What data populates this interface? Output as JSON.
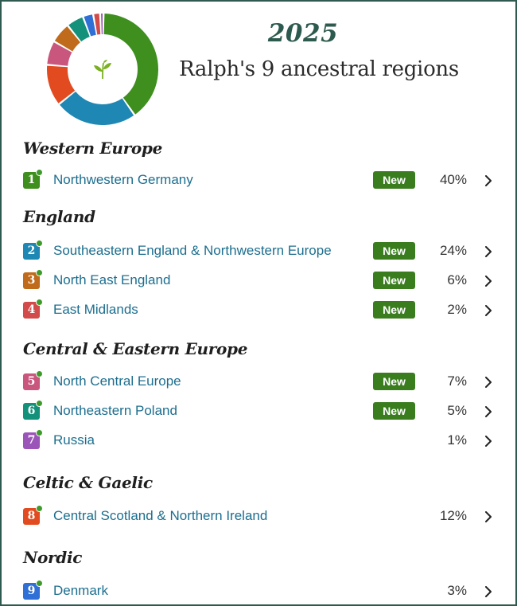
{
  "header": {
    "year": "2025",
    "headline": "Ralph's 9 ancestral regions"
  },
  "chart_data": {
    "type": "pie",
    "style": "donut",
    "categories": [
      "Northwestern Germany",
      "Southeastern England & Northwestern Europe",
      "Central Scotland & Northern Ireland",
      "North Central Europe",
      "North East England",
      "Northeastern Poland",
      "Denmark",
      "East Midlands",
      "Russia"
    ],
    "values": [
      40,
      24,
      12,
      7,
      6,
      5,
      3,
      2,
      1
    ],
    "colors": [
      "#3f8f1f",
      "#1e87b3",
      "#e24b1f",
      "#c9567d",
      "#c06a1b",
      "#14917a",
      "#2f6fd6",
      "#d24a4a",
      "#9b55b8"
    ],
    "center_icon": "ancestry-leaf-icon"
  },
  "groups": [
    {
      "title": "Western Europe",
      "regions": [
        {
          "num": "1",
          "name": "Northwestern Germany",
          "new": true,
          "percent": "40%",
          "color": "#3f8f1f"
        }
      ]
    },
    {
      "title": "England",
      "regions": [
        {
          "num": "2",
          "name": "Southeastern England & Northwestern Europe",
          "new": true,
          "percent": "24%",
          "color": "#1e87b3"
        },
        {
          "num": "3",
          "name": "North East England",
          "new": true,
          "percent": "6%",
          "color": "#c06a1b"
        },
        {
          "num": "4",
          "name": "East Midlands",
          "new": true,
          "percent": "2%",
          "color": "#d24a4a"
        }
      ]
    },
    {
      "title": "Central & Eastern Europe",
      "regions": [
        {
          "num": "5",
          "name": "North Central Europe",
          "new": true,
          "percent": "7%",
          "color": "#c9567d"
        },
        {
          "num": "6",
          "name": "Northeastern Poland",
          "new": true,
          "percent": "5%",
          "color": "#14917a"
        },
        {
          "num": "7",
          "name": "Russia",
          "new": false,
          "percent": "1%",
          "color": "#9b55b8"
        }
      ]
    },
    {
      "title": "Celtic & Gaelic",
      "regions": [
        {
          "num": "8",
          "name": "Central Scotland & Northern Ireland",
          "new": false,
          "percent": "12%",
          "color": "#e24b1f"
        }
      ]
    },
    {
      "title": "Nordic",
      "regions": [
        {
          "num": "9",
          "name": "Denmark",
          "new": false,
          "percent": "3%",
          "color": "#2f6fd6"
        }
      ]
    }
  ],
  "labels": {
    "new_tag": "New"
  },
  "icons": {
    "new_indicator": "new-dot-icon",
    "row_action": "chevron-right-icon"
  }
}
